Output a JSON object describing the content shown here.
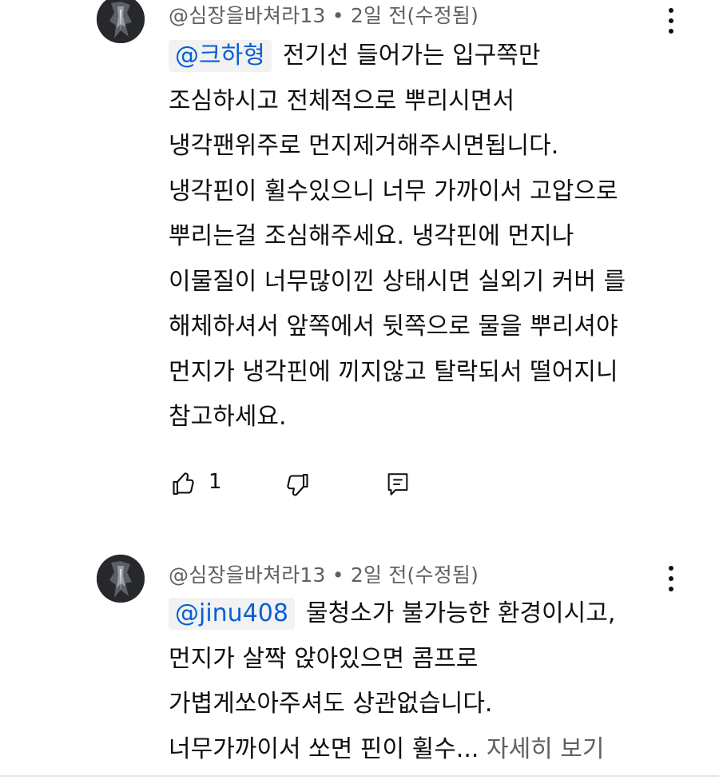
{
  "comments": [
    {
      "author": "@심장을바쳐라13",
      "time": "2일 전(수정됨)",
      "mention": "@크하형",
      "lines": [
        "전기선 들어가는 입구쪽만",
        "조심하시고 전체적으로 뿌리시면서",
        "냉각팬위주로 먼지제거해주시면됩니다.",
        "냉각핀이 휠수있으니 너무 가까이서 고압으로",
        "뿌리는걸 조심해주세요. 냉각핀에 먼지나",
        "이물질이 너무많이낀 상태시면 실외기 커버 를",
        "해체하셔서 앞쪽에서 뒷쪽으로 물을 뿌리셔야",
        "먼지가 냉각핀에 끼지않고 탈락되서 떨어지니",
        "참고하세요."
      ],
      "like_count": "1",
      "icons": {
        "like": "thumbs-up-icon",
        "dislike": "thumbs-down-icon",
        "reply": "reply-icon",
        "menu": "more-vert-icon"
      }
    },
    {
      "author": "@심장을바쳐라13",
      "time": "2일 전(수정됨)",
      "mention": "@jinu408",
      "lines": [
        "물청소가 불가능한 환경이시고,",
        "먼지가 살짝 앉아있으면 콤프로",
        "가볍게쏘아주셔도 상관없습니다.",
        "너무가까이서 쏘면 핀이 휠수..."
      ],
      "read_more": "자세히 보기",
      "icons": {
        "menu": "more-vert-icon"
      }
    }
  ],
  "separator": "•",
  "colors": {
    "text": "#0f0f0f",
    "meta": "#606060",
    "mention": "#065fd4",
    "mention_bg": "#f2f2f2"
  }
}
